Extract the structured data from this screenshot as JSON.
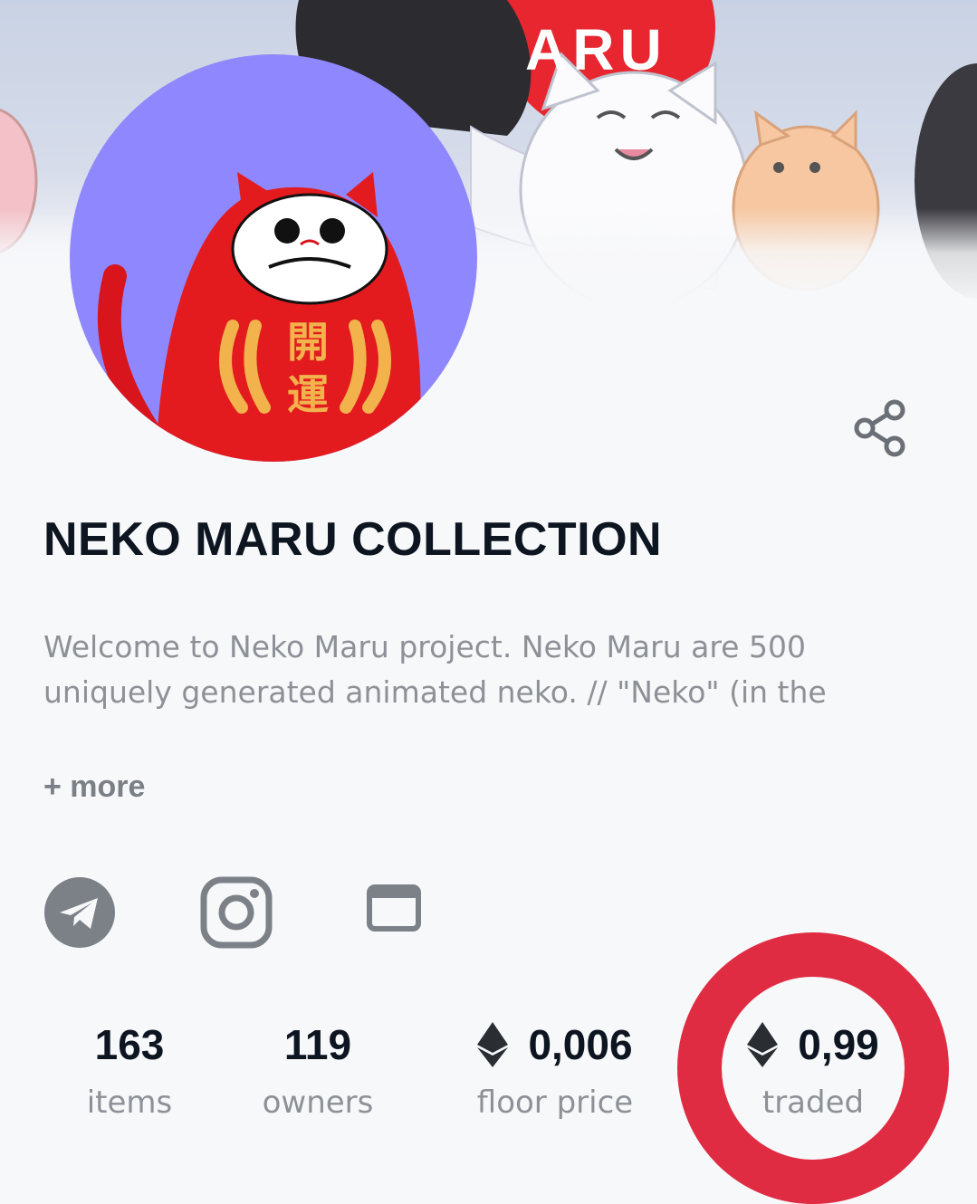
{
  "banner": {
    "text": "ARU"
  },
  "avatar": {
    "kanji_1": "開",
    "kanji_2": "運"
  },
  "collection": {
    "title": "NEKO MARU COLLECTION",
    "description_line_1": "Welcome to Neko Maru project. Neko Maru are 500",
    "description_line_2": "uniquely generated animated neko. // \"Neko\" (in the",
    "more_label": "+ more"
  },
  "social": [
    "telegram-icon",
    "instagram-icon",
    "website-icon"
  ],
  "stats": {
    "items": {
      "value": "163",
      "label": "items"
    },
    "owners": {
      "value": "119",
      "label": "owners"
    },
    "floor": {
      "value": "0,006",
      "label": "floor price"
    },
    "traded": {
      "value": "0,99",
      "label": "traded"
    }
  },
  "colors": {
    "avatar_bg": "#8f87fd",
    "highlight_ring": "#df2c42",
    "title": "#0d1521",
    "muted": "#8d9197"
  }
}
